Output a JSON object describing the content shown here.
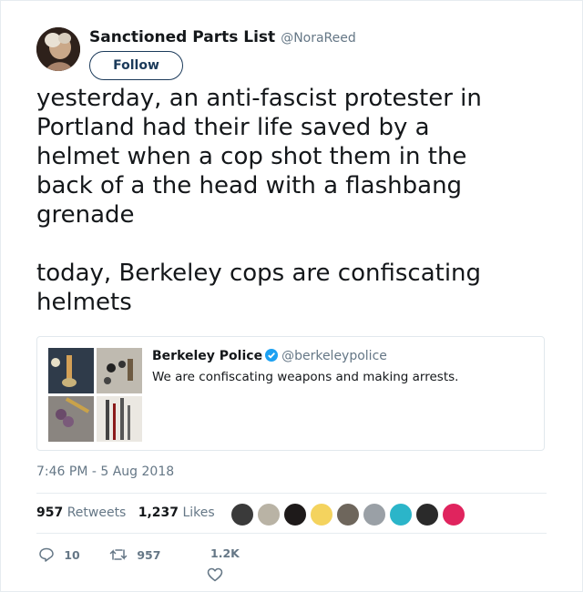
{
  "author": {
    "name": "Sanctioned Parts List",
    "handle": "@NoraReed",
    "follow_label": "Follow"
  },
  "tweet": {
    "text": "yesterday, an anti-fascist protester in\nPortland had their life saved by a\nhelmet when a cop shot them in the\nback of a the head with a flashbang\ngrenade\n\ntoday, Berkeley cops are confiscating\nhelmets"
  },
  "quote": {
    "name": "Berkeley Police",
    "handle": "@berkeleypolice",
    "text": "We are confiscating weapons and making arrests.",
    "verified": true
  },
  "timestamp": "7:46 PM - 5 Aug 2018",
  "stats": {
    "retweets_count": "957",
    "retweets_label": "Retweets",
    "likes_count": "1,237",
    "likes_label": "Likes"
  },
  "actions": {
    "replies": "10",
    "retweets": "957",
    "likes": "1.2K"
  },
  "icons": {
    "reply": "reply-icon",
    "retweet": "retweet-icon",
    "like": "heart-icon",
    "verified": "verified-badge-icon"
  },
  "colors": {
    "verified": "#1da1f2",
    "follow_border": "#1b3a5a",
    "muted": "#657786"
  }
}
